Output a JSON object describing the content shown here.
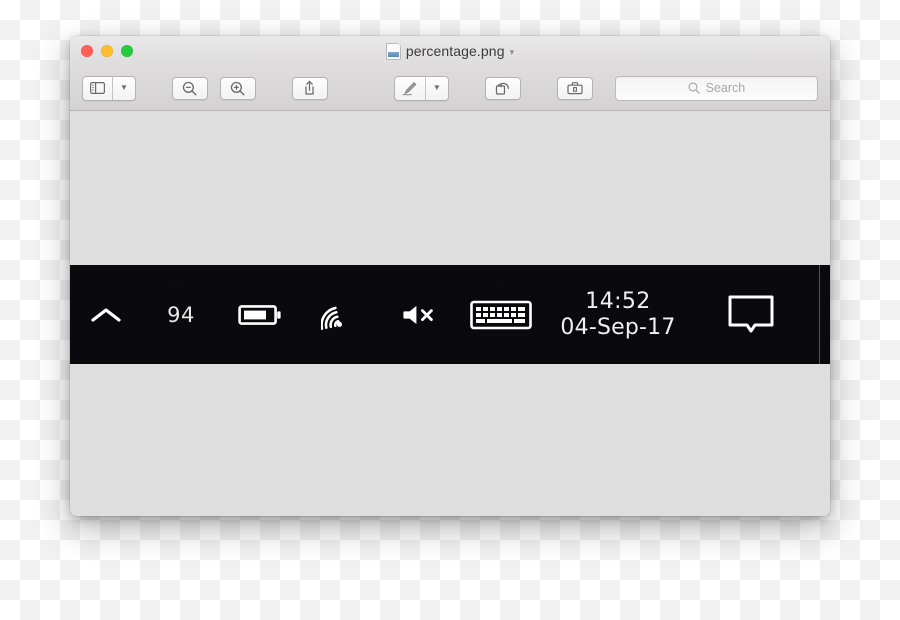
{
  "window": {
    "title": "percentage.png",
    "title_chevron": "chevron-down",
    "traffic_lights": [
      {
        "name": "close",
        "color": "#ff5f56"
      },
      {
        "name": "minimize",
        "color": "#ffbd2e"
      },
      {
        "name": "zoom",
        "color": "#27c93f"
      }
    ]
  },
  "toolbar": {
    "sidebar_button": {
      "icon": "sidebar-icon",
      "chevron": "chevron-down"
    },
    "zoom_out_button": {
      "icon": "zoom-out-icon",
      "label": "Zoom Out"
    },
    "zoom_in_button": {
      "icon": "zoom-in-icon",
      "label": "Zoom In"
    },
    "share_button": {
      "icon": "share-icon",
      "label": "Share"
    },
    "markup_button": {
      "icon": "pen-icon",
      "chevron": "chevron-down"
    },
    "rotate_button": {
      "icon": "rotate-left-icon",
      "label": "Rotate Left"
    },
    "markup_toolbar_button": {
      "icon": "toolbox-icon",
      "label": "Show Markup Toolbar"
    },
    "search": {
      "icon": "search-icon",
      "placeholder": "Search",
      "value": ""
    }
  },
  "image_content": {
    "description": "windows-taskbar-system-tray",
    "background_color": "#0a0a0e",
    "tray": {
      "show_hidden_icons": {
        "icon": "chevron-up-icon",
        "label": "Show hidden icons"
      },
      "battery_percentage": "94",
      "battery_icon": {
        "icon": "battery-icon",
        "label": "Battery"
      },
      "network_icon": {
        "icon": "wifi-icon",
        "label": "Network"
      },
      "volume_icon": {
        "icon": "speaker-muted-icon",
        "label": "Volume muted"
      },
      "keyboard_icon": {
        "icon": "keyboard-icon",
        "label": "Touch keyboard"
      },
      "clock": {
        "time": "14:52",
        "date": "04-Sep-17"
      },
      "action_center_icon": {
        "icon": "notification-bubble-icon",
        "label": "Action Center"
      },
      "show_desktop": {
        "label": "Show desktop"
      }
    }
  }
}
